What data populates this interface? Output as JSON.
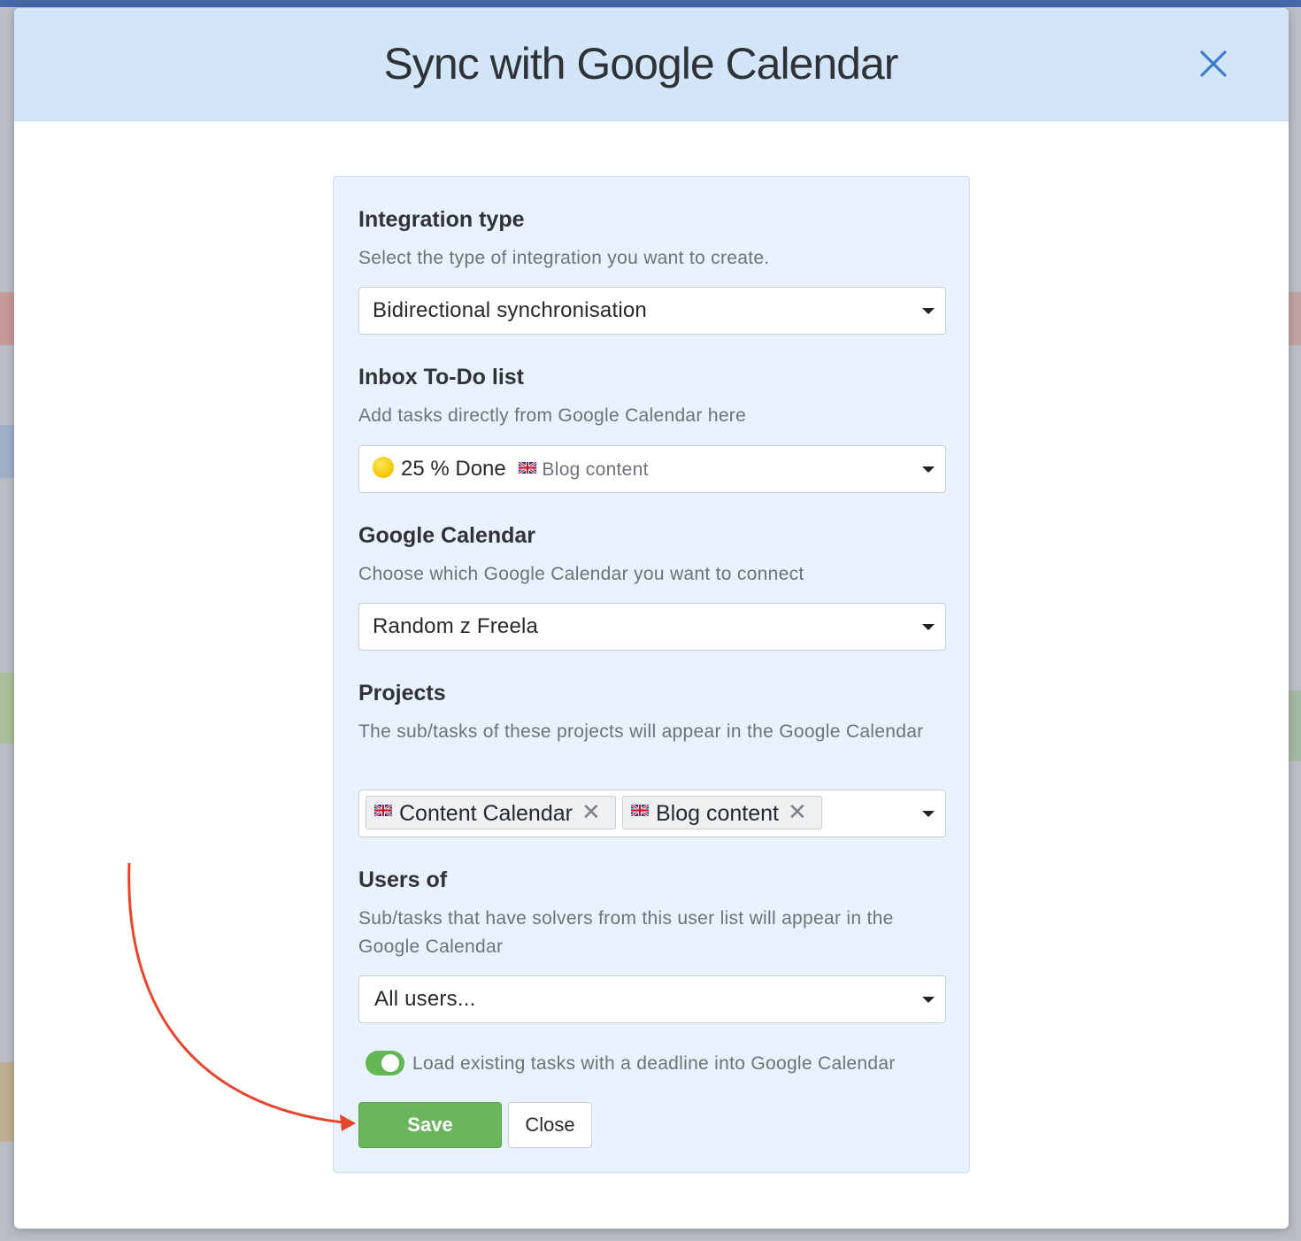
{
  "modal": {
    "title": "Sync with Google Calendar"
  },
  "integration_type": {
    "title": "Integration type",
    "description": "Select the type of integration you want to create.",
    "selected": "Bidirectional synchronisation"
  },
  "inbox": {
    "title": "Inbox To-Do list",
    "description": "Add tasks directly from Google Calendar here",
    "selected_name": "25 % Done",
    "selected_project": "Blog content"
  },
  "google_calendar": {
    "title": "Google Calendar",
    "description": "Choose which Google Calendar you want to connect",
    "selected": "Random z Freela"
  },
  "projects": {
    "title": "Projects",
    "description": "The sub/tasks of these projects will appear in the Google Calendar",
    "tags": [
      {
        "label": "Content Calendar",
        "remove": "✕"
      },
      {
        "label": "Blog content",
        "remove": "✕"
      }
    ]
  },
  "users": {
    "title": "Users of",
    "description": "Sub/tasks that have solvers from this user list will appear in the Google Calendar",
    "selected": "All users..."
  },
  "load_existing": {
    "label": "Load existing tasks with a deadline into Google Calendar",
    "enabled": true
  },
  "buttons": {
    "save": "Save",
    "close": "Close"
  },
  "colors": {
    "header_bg": "#d3e5f8",
    "panel_bg": "#e8f1fc",
    "save_green": "#6bb65c",
    "toggle_green": "#64b657",
    "close_icon_blue": "#3a7cc9",
    "annotation_arrow": "#e8452e"
  },
  "icons": {
    "close": "close-icon",
    "caret": "chevron-down-icon",
    "flag": "uk-flag-icon",
    "status": "yellow-circle-icon"
  }
}
